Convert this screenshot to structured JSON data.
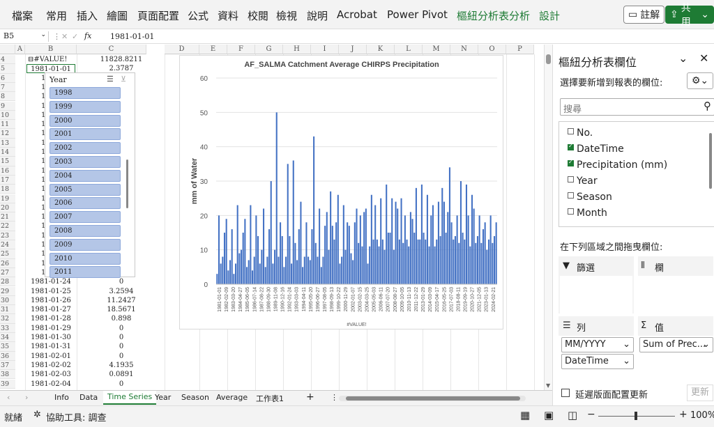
{
  "ribbon": {
    "tabs": [
      "檔案",
      "常用",
      "插入",
      "繪圖",
      "頁面配置",
      "公式",
      "資料",
      "校閱",
      "檢視",
      "說明",
      "Acrobat",
      "Power Pivot"
    ],
    "context_tabs": [
      "樞紐分析表分析",
      "設計"
    ],
    "comment_label": "註解",
    "share_label": "共用"
  },
  "formula": {
    "name_box": "B5",
    "fx": "fx",
    "value": "1981-01-01"
  },
  "grid": {
    "columns": [
      "A",
      "B",
      "C",
      "D",
      "E",
      "F",
      "G",
      "H",
      "I",
      "J",
      "K",
      "L",
      "M",
      "N",
      "O",
      "P"
    ],
    "rows": [
      "4",
      "5",
      "6",
      "7",
      "8",
      "9",
      "10",
      "11",
      "12",
      "13",
      "14",
      "15",
      "16",
      "17",
      "18",
      "19",
      "20",
      "21",
      "22",
      "23",
      "24",
      "25",
      "26",
      "27",
      "28",
      "29",
      "30",
      "31",
      "32",
      "33",
      "34",
      "35",
      "36",
      "37",
      "38",
      "39"
    ],
    "row4": {
      "b": "⊟#VALUE!",
      "c": "11828.8211"
    },
    "row5": {
      "b": "1981-01-01",
      "c": "2.3787"
    },
    "hidden_prefix": "19",
    "lower_rows": [
      {
        "b": "1981-01-24",
        "c": "0"
      },
      {
        "b": "1981-01-25",
        "c": "3.2594"
      },
      {
        "b": "1981-01-26",
        "c": "11.2427"
      },
      {
        "b": "1981-01-27",
        "c": "18.5671"
      },
      {
        "b": "1981-01-28",
        "c": "0.898"
      },
      {
        "b": "1981-01-29",
        "c": "0"
      },
      {
        "b": "1981-01-30",
        "c": "0"
      },
      {
        "b": "1981-01-31",
        "c": "0"
      },
      {
        "b": "1981-02-01",
        "c": "0"
      },
      {
        "b": "1981-02-02",
        "c": "4.1935"
      },
      {
        "b": "1981-02-03",
        "c": "0.0891"
      },
      {
        "b": "1981-02-04",
        "c": "0"
      }
    ]
  },
  "slicer": {
    "title": "Year",
    "items": [
      "1998",
      "1999",
      "2000",
      "2001",
      "2002",
      "2003",
      "2004",
      "2005",
      "2006",
      "2007",
      "2008",
      "2009",
      "2010",
      "2011"
    ]
  },
  "chart_data": {
    "type": "bar",
    "title": "AF_SALMA Catchment Average CHIRPS Precipitation",
    "ylabel": "mm of Water",
    "xlabel": "#VALUE!",
    "ylim": [
      0,
      60
    ],
    "yticks": [
      "0",
      "10",
      "20",
      "30",
      "40",
      "50",
      "60"
    ],
    "grid": true,
    "tick_labels": [
      "1981-01-01",
      "1982-02-09",
      "1983-03-20",
      "1984-04-27",
      "1985-06-05",
      "1986-07-14",
      "1987-08-22",
      "1988-09-30",
      "1989-11-08",
      "1990-12-16",
      "1992-01-24",
      "1993-03-03",
      "1994-04-11",
      "1995-05-20",
      "1996-06-27",
      "1997-08-05",
      "1998-09-13",
      "1999-10-22",
      "2000-11-29",
      "2002-01-07",
      "2003-02-15",
      "2004-03-25",
      "2005-05-03",
      "2006-06-11",
      "2007-07-20",
      "2008-08-27",
      "2009-10-05",
      "2010-11-13",
      "2011-12-22",
      "2013-01-29",
      "2014-03-09",
      "2015-04-17",
      "2016-05-25",
      "2017-07-03",
      "2018-08-11",
      "2019-09-19",
      "2020-10-27",
      "2021-12-05",
      "2023-01-13",
      "2024-02-21"
    ],
    "values": [
      3,
      20,
      6,
      8,
      15,
      19,
      4,
      7,
      16,
      3,
      6,
      23,
      9,
      10,
      15,
      19,
      5,
      7,
      23,
      4,
      8,
      20,
      14,
      6,
      10,
      22,
      5,
      8,
      16,
      30,
      6,
      10,
      50,
      8,
      18,
      14,
      5,
      8,
      35,
      14,
      6,
      36,
      12,
      7,
      16,
      24,
      5,
      8,
      18,
      8,
      7,
      16,
      43,
      12,
      8,
      22,
      5,
      8,
      17,
      21,
      10,
      27,
      17,
      13,
      18,
      26,
      6,
      8,
      23,
      10,
      18,
      17,
      9,
      7,
      18,
      22,
      12,
      20,
      11,
      21,
      22,
      6,
      11,
      26,
      13,
      23,
      13,
      11,
      25,
      13,
      10,
      29,
      15,
      15,
      25,
      10,
      24,
      22,
      13,
      25,
      12,
      20,
      13,
      11,
      21,
      19,
      15,
      28,
      13,
      13,
      29,
      15,
      13,
      26,
      11,
      20,
      23,
      11,
      13,
      24,
      14,
      28,
      24,
      15,
      21,
      34,
      18,
      13,
      14,
      20,
      12,
      30,
      15,
      13,
      29,
      20,
      11,
      26,
      22,
      12,
      14,
      20,
      12,
      16,
      18,
      10,
      13,
      20,
      12,
      14,
      18
    ]
  },
  "sheets": {
    "tabs": [
      "Info",
      "Data",
      "Time Series",
      "Year",
      "Season",
      "Average",
      "工作表1"
    ],
    "active": "Time Series",
    "add": "+"
  },
  "status": {
    "ready": "就緒",
    "accessibility": "協助工具: 調查",
    "zoom": "100%"
  },
  "pane": {
    "title": "樞紐分析表欄位",
    "choose": "選擇要新增到報表的欄位:",
    "search_placeholder": "搜尋",
    "fields": [
      {
        "name": "No.",
        "checked": false
      },
      {
        "name": "DateTime",
        "checked": true
      },
      {
        "name": "Precipitation (mm)",
        "checked": true
      },
      {
        "name": "Year",
        "checked": false
      },
      {
        "name": "Season",
        "checked": false
      },
      {
        "name": "Month",
        "checked": false
      }
    ],
    "drag_label": "在下列區域之間拖曳欄位:",
    "filters_label": "篩選",
    "columns_label": "欄",
    "rows_label": "列",
    "values_label": "值",
    "row_fields": [
      "MM/YYYY",
      "DateTime"
    ],
    "value_fields": [
      "Sum of Prec..."
    ],
    "defer_label": "延遲版面配置更新",
    "update_label": "更新"
  }
}
